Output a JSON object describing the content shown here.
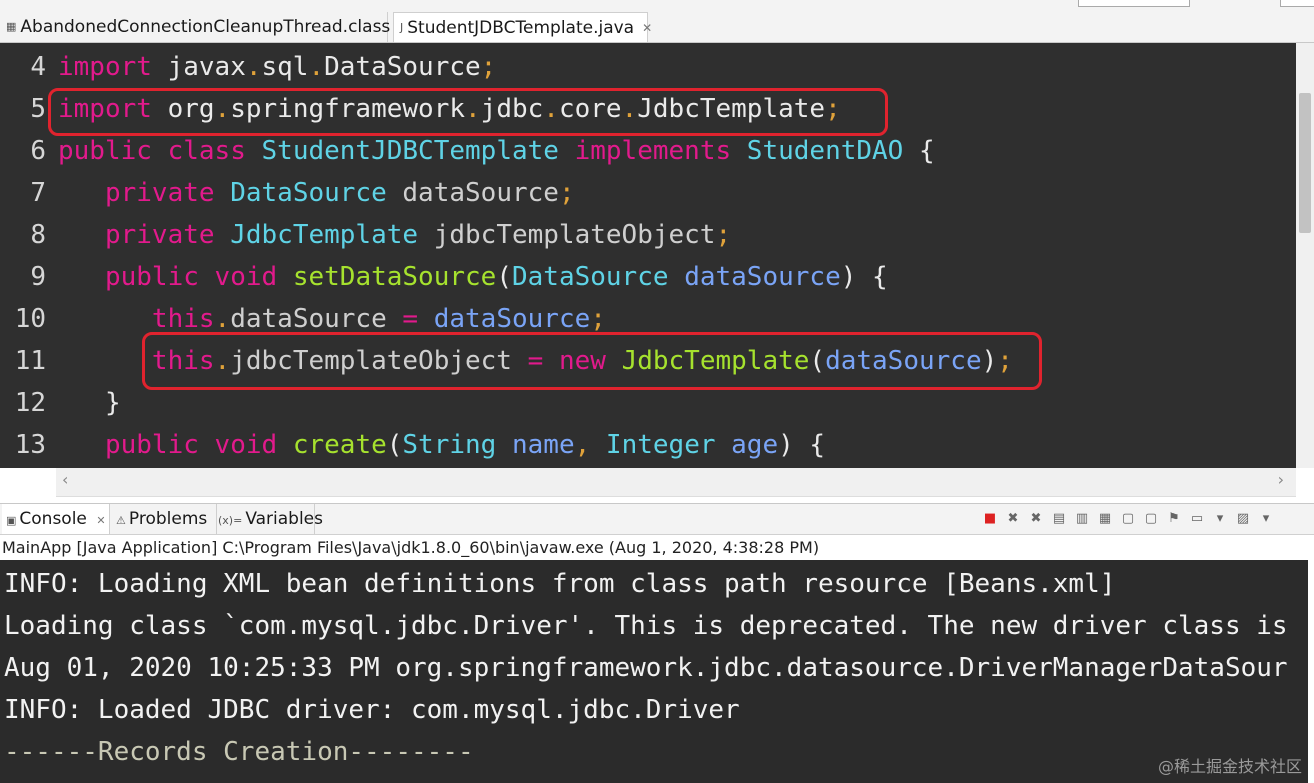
{
  "editor_tabs": [
    {
      "label": "AbandonedConnectionCleanupThread.class",
      "icon": "class-file-icon",
      "active": false
    },
    {
      "label": "StudentJDBCTemplate.java",
      "icon": "java-file-icon",
      "active": true,
      "close": "✕"
    }
  ],
  "code_lines": [
    {
      "num": "4",
      "segments": [
        [
          "k",
          "import"
        ],
        [
          "s",
          " javax"
        ],
        [
          "o",
          "."
        ],
        [
          "s",
          "sql"
        ],
        [
          "o",
          "."
        ],
        [
          "s",
          "DataSource"
        ],
        [
          "o",
          ";"
        ]
      ]
    },
    {
      "num": "5",
      "segments": [
        [
          "k",
          "import"
        ],
        [
          "s",
          " "
        ],
        [
          "s",
          "org"
        ],
        [
          "o",
          "."
        ],
        [
          "s",
          "springframework"
        ],
        [
          "o",
          "."
        ],
        [
          "s",
          "jdbc"
        ],
        [
          "o",
          "."
        ],
        [
          "s",
          "core"
        ],
        [
          "o",
          "."
        ],
        [
          "s",
          "JdbcTemplate"
        ],
        [
          "o",
          ";"
        ]
      ]
    },
    {
      "num": "6",
      "segments": [
        [
          "k",
          "public"
        ],
        [
          "s",
          " "
        ],
        [
          "k",
          "class"
        ],
        [
          "s",
          " "
        ],
        [
          "t",
          "StudentJDBCTemplate"
        ],
        [
          "s",
          " "
        ],
        [
          "k",
          "implements"
        ],
        [
          "s",
          " "
        ],
        [
          "t",
          "StudentDAO"
        ],
        [
          "s",
          " {"
        ]
      ]
    },
    {
      "num": "7",
      "segments": [
        [
          "s",
          "   "
        ],
        [
          "k",
          "private"
        ],
        [
          "s",
          " "
        ],
        [
          "t",
          "DataSource"
        ],
        [
          "s",
          " "
        ],
        [
          "p",
          "dataSource"
        ],
        [
          "o",
          ";"
        ]
      ]
    },
    {
      "num": "8",
      "segments": [
        [
          "s",
          "   "
        ],
        [
          "k",
          "private"
        ],
        [
          "s",
          " "
        ],
        [
          "t",
          "JdbcTemplate"
        ],
        [
          "s",
          " "
        ],
        [
          "p",
          "jdbcTemplateObject"
        ],
        [
          "o",
          ";"
        ]
      ]
    },
    {
      "num": "9",
      "segments": [
        [
          "s",
          "   "
        ],
        [
          "k",
          "public"
        ],
        [
          "s",
          " "
        ],
        [
          "k",
          "void"
        ],
        [
          "s",
          " "
        ],
        [
          "f",
          "setDataSource"
        ],
        [
          "s",
          "("
        ],
        [
          "t",
          "DataSource"
        ],
        [
          "s",
          " "
        ],
        [
          "v",
          "dataSource"
        ],
        [
          "s",
          ") {"
        ]
      ]
    },
    {
      "num": "10",
      "segments": [
        [
          "s",
          "      "
        ],
        [
          "k",
          "this"
        ],
        [
          "o",
          "."
        ],
        [
          "p",
          "dataSource"
        ],
        [
          "s",
          " "
        ],
        [
          "k",
          "="
        ],
        [
          "s",
          " "
        ],
        [
          "v",
          "dataSource"
        ],
        [
          "o",
          ";"
        ]
      ]
    },
    {
      "num": "11",
      "segments": [
        [
          "s",
          "      "
        ],
        [
          "k",
          "this"
        ],
        [
          "o",
          "."
        ],
        [
          "p",
          "jdbcTemplateObject"
        ],
        [
          "s",
          " "
        ],
        [
          "k",
          "="
        ],
        [
          "s",
          " "
        ],
        [
          "k",
          "new"
        ],
        [
          "s",
          " "
        ],
        [
          "f",
          "JdbcTemplate"
        ],
        [
          "s",
          "("
        ],
        [
          "v",
          "dataSource"
        ],
        [
          "s",
          ")"
        ],
        [
          "o",
          ";"
        ]
      ]
    },
    {
      "num": "12",
      "segments": [
        [
          "s",
          "   }"
        ]
      ]
    },
    {
      "num": "13",
      "segments": [
        [
          "s",
          "   "
        ],
        [
          "k",
          "public"
        ],
        [
          "s",
          " "
        ],
        [
          "k",
          "void"
        ],
        [
          "s",
          " "
        ],
        [
          "f",
          "create"
        ],
        [
          "s",
          "("
        ],
        [
          "t",
          "String"
        ],
        [
          "s",
          " "
        ],
        [
          "v",
          "name"
        ],
        [
          "o",
          ","
        ],
        [
          "s",
          " "
        ],
        [
          "t",
          "Integer"
        ],
        [
          "s",
          " "
        ],
        [
          "v",
          "age"
        ],
        [
          "s",
          ") {"
        ]
      ]
    }
  ],
  "panel_tabs": [
    {
      "label": "Console",
      "icon": "console-icon",
      "close": "✕"
    },
    {
      "label": "Problems",
      "icon": "problems-icon"
    },
    {
      "label": "Variables",
      "icon": "variables-icon",
      "prefix": "(x)="
    }
  ],
  "launch_info": "MainApp [Java Application] C:\\Program Files\\Java\\jdk1.8.0_60\\bin\\javaw.exe (Aug 1, 2020, 4:38:28 PM)",
  "console_lines": [
    "INFO: Loading XML bean definitions from class path resource [Beans.xml]",
    "Loading class `com.mysql.jdbc.Driver'. This is deprecated. The new driver class is",
    "Aug 01, 2020 10:25:33 PM org.springframework.jdbc.datasource.DriverManagerDataSour",
    "INFO: Loaded JDBC driver: com.mysql.jdbc.Driver",
    "------Records Creation--------"
  ],
  "watermark": "@稀土掘金技术社区",
  "colors": {
    "keyword": "#e21a8c",
    "type": "#5fd3e6",
    "method": "#a6e22e",
    "param": "#7aa4f6",
    "highlight_box": "#e0232e"
  }
}
